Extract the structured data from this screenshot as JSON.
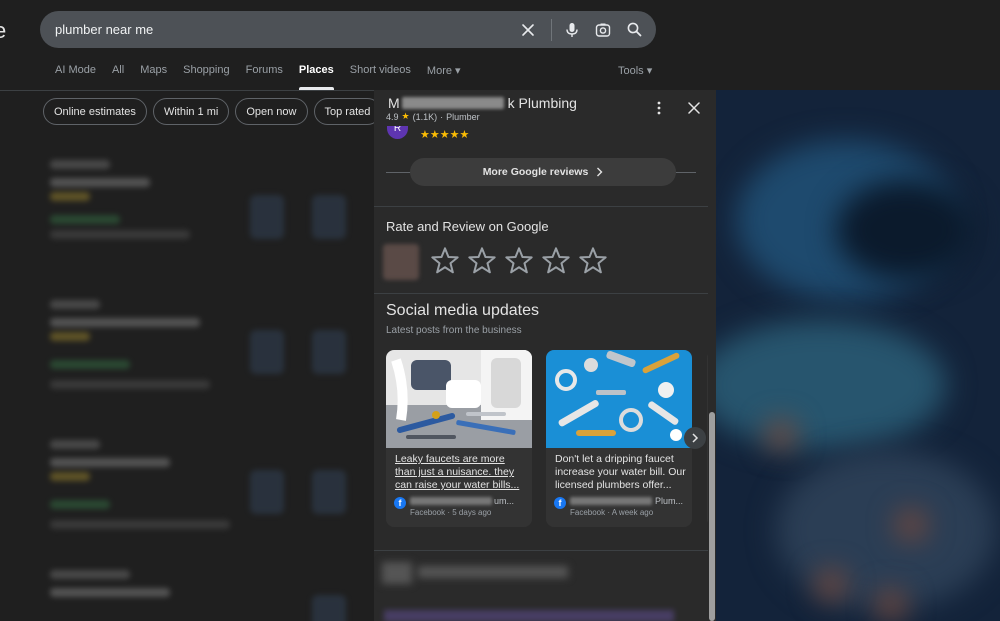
{
  "header": {
    "logo_fragment": "e",
    "search": {
      "query": "plumber near me"
    },
    "tabs": [
      {
        "label": "AI Mode",
        "active": false
      },
      {
        "label": "All",
        "active": false
      },
      {
        "label": "Maps",
        "active": false
      },
      {
        "label": "Shopping",
        "active": false
      },
      {
        "label": "Forums",
        "active": false
      },
      {
        "label": "Places",
        "active": true
      },
      {
        "label": "Short videos",
        "active": false
      },
      {
        "label": "More ▾",
        "active": false
      }
    ],
    "tools_label": "Tools ▾"
  },
  "filters": {
    "chips": [
      "Online estimates",
      "Within 1 mi",
      "Open now",
      "Top rated"
    ]
  },
  "panel": {
    "business_name_prefix": "M",
    "business_name_suffix": "k Plumbing",
    "rating": "4.9",
    "review_count": "(1.1K)",
    "separator": "·",
    "category": "Plumber",
    "reviewer_initial": "R",
    "review_stars": "★★★★★",
    "more_reviews_label": "More Google reviews",
    "rate_title": "Rate and Review on Google",
    "social_title": "Social media updates",
    "social_subtitle": "Latest posts from the business",
    "posts": [
      {
        "text": "Leaky faucets are more than just a nuisance. they can raise your water bills...",
        "author_suffix": "um...",
        "meta": "Facebook · 5 days ago",
        "source_icon": "facebook-icon"
      },
      {
        "text": "Don't let a dripping faucet increase your water bill. Our licensed plumbers offer...",
        "author_suffix": "Plum...",
        "meta": "Facebook · A week ago",
        "source_icon": "facebook-icon"
      }
    ]
  },
  "colors": {
    "background": "#1f1f1f",
    "panel": "#2a2a2a",
    "star_yellow": "#fbbc04",
    "facebook_blue": "#1877f2",
    "avatar_purple": "#5e35b1"
  }
}
